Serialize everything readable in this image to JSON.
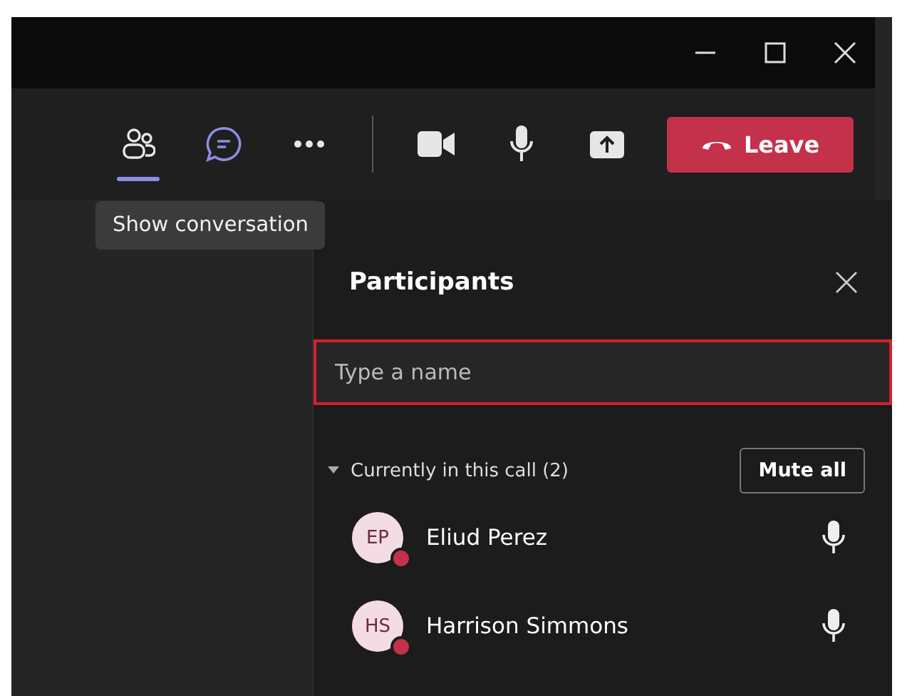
{
  "toolbar": {
    "view_buttons": [
      {
        "kind": "people",
        "selected": true
      },
      {
        "kind": "chat",
        "selected": false,
        "tooltip": "Show conversation"
      },
      {
        "kind": "more",
        "selected": false
      }
    ],
    "call_buttons": [
      {
        "kind": "camera"
      },
      {
        "kind": "mic"
      },
      {
        "kind": "share"
      }
    ],
    "leave_button": {
      "label": "Leave"
    }
  },
  "participants_panel": {
    "title": "Participants",
    "search": {
      "placeholder": "Type a name",
      "highlighted": true
    },
    "section": {
      "label": "Currently in this call (2)",
      "expanded": true,
      "mute_all": "Mute all"
    },
    "people": [
      {
        "initials": "EP",
        "name": "Eliud Perez",
        "color": "#c4314b",
        "muted": false
      },
      {
        "initials": "HS",
        "name": "Harrison Simmons",
        "color": "#c4314b",
        "muted": false
      }
    ]
  }
}
